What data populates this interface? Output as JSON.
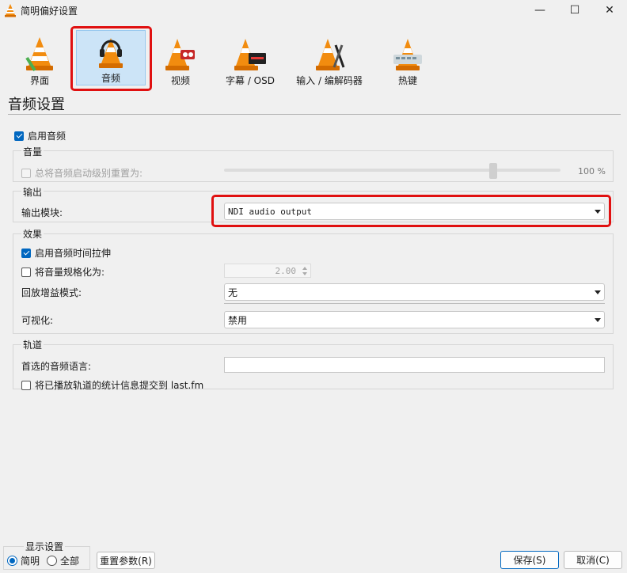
{
  "window": {
    "title": "简明偏好设置",
    "minimize_glyph": "—",
    "maximize_glyph": "☐",
    "close_glyph": "✕"
  },
  "toolbar": {
    "items": [
      {
        "label": "界面",
        "icon": "vlc-cone-icon"
      },
      {
        "label": "音频",
        "icon": "headphones-cone-icon"
      },
      {
        "label": "视频",
        "icon": "video-cone-icon"
      },
      {
        "label": "字幕 / OSD",
        "icon": "subtitle-cone-icon"
      },
      {
        "label": "输入 / 编解码器",
        "icon": "codec-cone-icon"
      },
      {
        "label": "热键",
        "icon": "hotkeys-cone-icon"
      }
    ],
    "active_index": 1
  },
  "page": {
    "title": "音频设置",
    "enable_audio": "启用音频"
  },
  "volume_group": {
    "title": "音量",
    "reset_label": "总将音频启动级别重置为:",
    "level": 100,
    "level_text": "100 %"
  },
  "output_group": {
    "title": "输出",
    "module_label": "输出模块:",
    "module_value": "NDI audio output"
  },
  "effects_group": {
    "title": "效果",
    "time_stretch": "启用音频时间拉伸",
    "normalize_label": "将音量规格化为:",
    "normalize_value": "2.00",
    "replay_gain_label": "回放增益模式:",
    "replay_gain_value": "无",
    "visualization_label": "可视化:",
    "visualization_value": "禁用"
  },
  "tracks_group": {
    "title": "轨道",
    "preferred_lang_label": "首选的音频语言:",
    "preferred_lang_value": "",
    "lastfm_label": "将已播放轨道的统计信息提交到 last.fm"
  },
  "footer": {
    "show_settings_title": "显示设置",
    "simple": "简明",
    "all": "全部",
    "reset_button": "重置参数(R)",
    "save_button": "保存(S)",
    "cancel_button": "取消(C)"
  },
  "colors": {
    "accent": "#0067c0",
    "highlight_border": "#e01010",
    "active_tab_bg": "#cce4f7",
    "cone_orange": "#f28c0f"
  }
}
